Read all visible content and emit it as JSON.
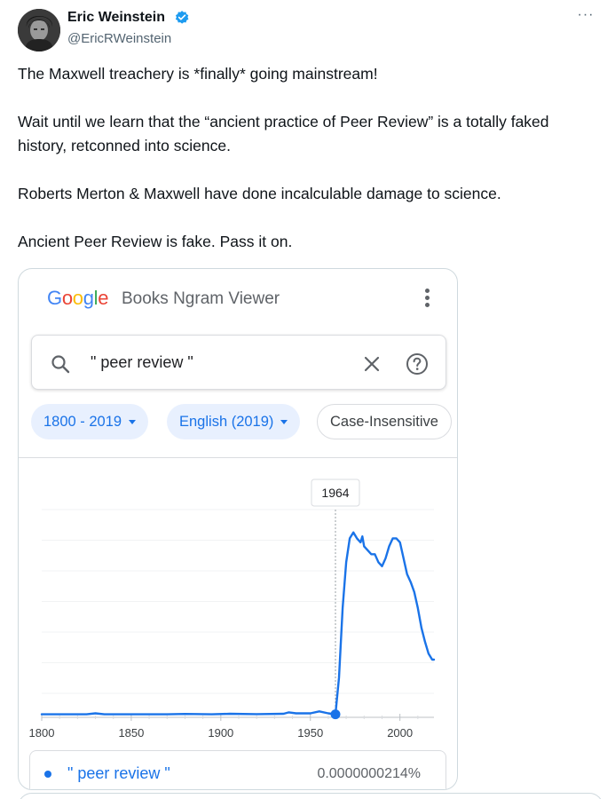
{
  "tweet": {
    "author_name": "Eric Weinstein",
    "author_handle": "@EricRWeinstein",
    "more_label": "···",
    "paragraphs": [
      "The Maxwell treachery is *finally* going mainstream!",
      "Wait until we learn that the “ancient practice of Peer Review” is a totally faked history, retconned into science.",
      "Roberts Merton & Maxwell have done incalculable damage to science.",
      "Ancient Peer Review is fake. Pass it on."
    ]
  },
  "ngram": {
    "logo": {
      "G": "G",
      "o1": "o",
      "o2": "o",
      "g": "g",
      "l": "l",
      "e": "e"
    },
    "title": "Books Ngram Viewer",
    "search_value": "\" peer review \"",
    "chips": {
      "year_range": "1800 - 2019",
      "corpus": "English (2019)",
      "case": "Case-Insensitive"
    },
    "legend": {
      "label": "\" peer review \"",
      "value": "0.0000000214%"
    },
    "accent_color": "#1a73e8"
  },
  "chart_data": {
    "type": "line",
    "x_ticks": [
      "1800",
      "1850",
      "1900",
      "1950",
      "2000"
    ],
    "xlim": [
      1800,
      2019
    ],
    "ylim": [
      0,
      1
    ],
    "y_tick_labels": false,
    "grid": true,
    "tooltip": "1964",
    "highlight_point": {
      "x": 1964,
      "y": 0.015
    },
    "series": [
      {
        "color": "#1a73e8",
        "x": [
          1800,
          1812,
          1825,
          1830,
          1835,
          1850,
          1870,
          1880,
          1895,
          1905,
          1920,
          1935,
          1938,
          1942,
          1950,
          1955,
          1960,
          1964,
          1966,
          1968,
          1970,
          1972,
          1974,
          1976,
          1978,
          1979,
          1980,
          1982,
          1984,
          1986,
          1988,
          1990,
          1992,
          1994,
          1996,
          1998,
          2000,
          2002,
          2004,
          2006,
          2008,
          2010,
          2012,
          2014,
          2016,
          2018,
          2019
        ],
        "y": [
          0.015,
          0.015,
          0.015,
          0.02,
          0.015,
          0.015,
          0.015,
          0.017,
          0.015,
          0.018,
          0.016,
          0.018,
          0.025,
          0.02,
          0.02,
          0.03,
          0.02,
          0.015,
          0.2,
          0.55,
          0.78,
          0.9,
          0.93,
          0.9,
          0.88,
          0.91,
          0.86,
          0.84,
          0.82,
          0.82,
          0.78,
          0.76,
          0.8,
          0.86,
          0.9,
          0.9,
          0.88,
          0.8,
          0.72,
          0.68,
          0.63,
          0.55,
          0.45,
          0.38,
          0.32,
          0.29,
          0.29
        ]
      }
    ]
  }
}
